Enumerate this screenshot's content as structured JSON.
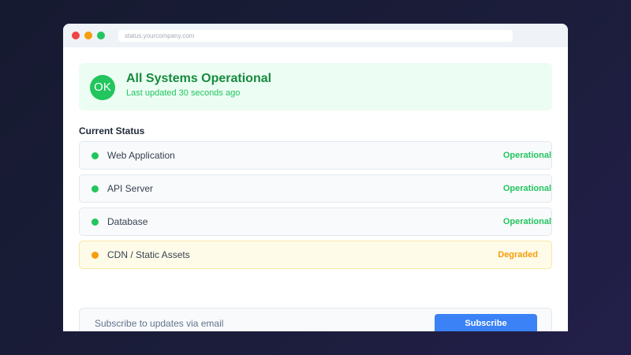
{
  "browser": {
    "url": "status.yourcompany.com"
  },
  "banner": {
    "icon_text": "OK",
    "title": "All Systems Operational",
    "subtitle": "Last updated 30 seconds ago"
  },
  "section": {
    "title": "Current Status"
  },
  "services": [
    {
      "name": "Web Application",
      "status": "Operational",
      "color": "#22c55e"
    },
    {
      "name": "API Server",
      "status": "Operational",
      "color": "#22c55e"
    },
    {
      "name": "Database",
      "status": "Operational",
      "color": "#22c55e"
    },
    {
      "name": "CDN / Static Assets",
      "status": "Degraded",
      "color": "#f59e0b"
    }
  ],
  "subscribe": {
    "placeholder": "Subscribe to updates via email",
    "button_label": "Subscribe"
  },
  "colors": {
    "operational": "#22c55e",
    "degraded": "#f59e0b",
    "accent": "#3b82f6"
  }
}
